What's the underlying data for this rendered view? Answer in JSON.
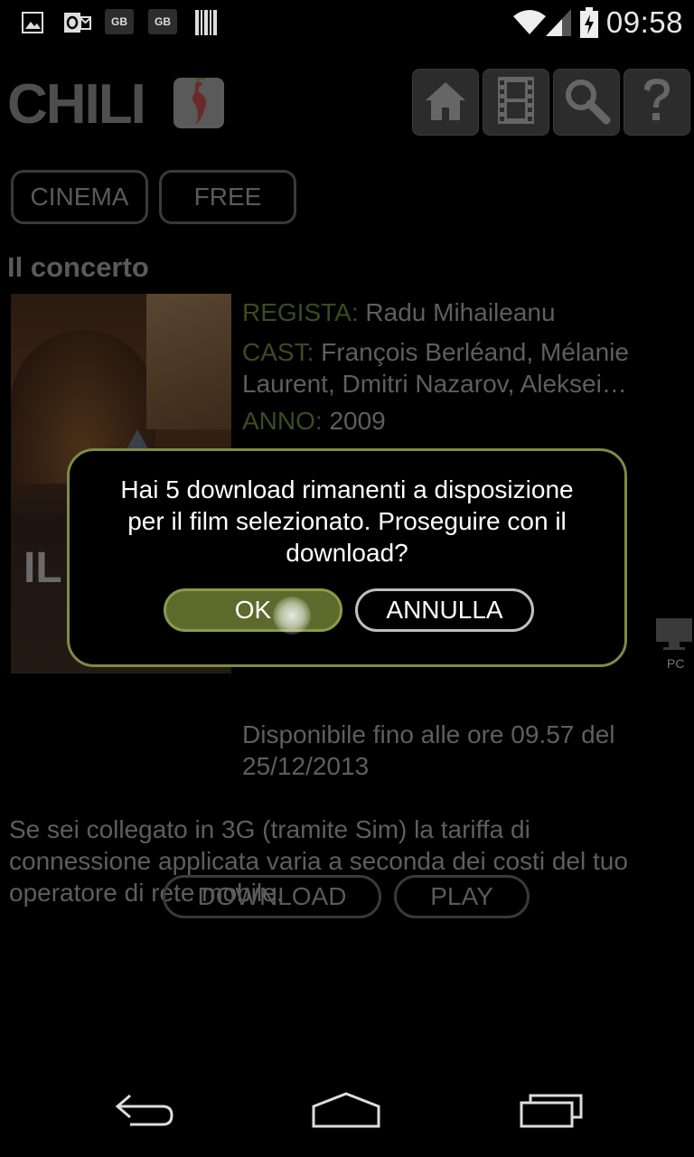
{
  "status_bar": {
    "time": "09:58",
    "notif_icons": [
      "image-icon",
      "outlook-icon",
      "gb-badge-icon",
      "gb-badge-icon",
      "barcode-icon"
    ],
    "gb_label": "GB"
  },
  "header": {
    "logo_text": "CHILI",
    "nav_icons": [
      "home-icon",
      "film-icon",
      "search-icon",
      "help-icon"
    ]
  },
  "categories": {
    "cinema": "CINEMA",
    "free": "FREE"
  },
  "movie": {
    "title": "Il concerto",
    "regista_label": "REGISTA:",
    "regista": "Radu Mihaileanu",
    "cast_label": "CAST:",
    "cast_line1": "François Berléand, Mélanie",
    "cast_line2": "Laurent, Dmitri Nazarov, Aleksei…",
    "anno_label": "ANNO:",
    "anno": "2009",
    "poster_text": "IL CO",
    "side_label": "PC",
    "available_line1": "Disponibile fino alle ore 09.57 del",
    "available_line2": "25/12/2013",
    "note_line1": "Se sei collegato in 3G (tramite Sim) la tariffa di",
    "note_line2": "connessione applicata varia a seconda dei costi del tuo",
    "note_line3": "operatore di rete mobile.",
    "download_label": "DOWNLOAD",
    "play_label": "PLAY"
  },
  "dialog": {
    "line1": "Hai 5 download rimanenti a disposizione",
    "line2": "per il film selezionato. Proseguire con il",
    "line3": "download?",
    "ok_label": "OK",
    "cancel_label": "ANNULLA"
  },
  "colors": {
    "accent": "#7d8b46",
    "ok_fill": "#5d6a2b"
  },
  "navbar": {
    "icons": [
      "back-icon",
      "home-icon",
      "recents-icon"
    ]
  }
}
